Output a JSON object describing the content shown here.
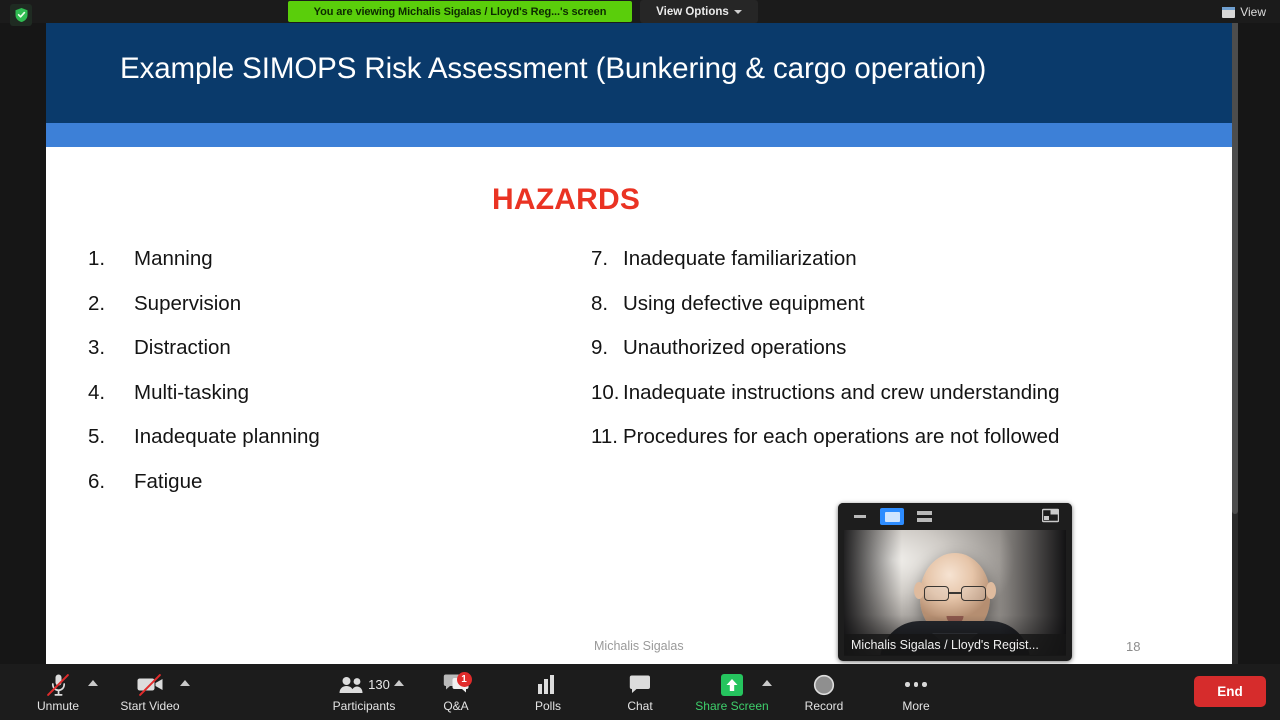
{
  "topbar": {
    "security_icon": "shield-check-icon",
    "viewing_banner": "You are viewing Michalis Sigalas / Lloyd's Reg...'s screen",
    "view_options_label": "View Options",
    "view_options_icon": "chevron-down-icon",
    "view_label": "View",
    "view_icon": "layout-window-icon"
  },
  "slide": {
    "title": "Example SIMOPS Risk Assessment  (Bunkering & cargo operation)",
    "heading": "HAZARDS",
    "heading_color": "#ea3323",
    "header_color": "#0a3a6b",
    "accent_color": "#3d80d7",
    "left_items": [
      {
        "num": "1.",
        "text": "Manning"
      },
      {
        "num": "2.",
        "text": "Supervision"
      },
      {
        "num": "3.",
        "text": "Distraction"
      },
      {
        "num": "4.",
        "text": "Multi-tasking"
      },
      {
        "num": "5.",
        "text": "Inadequate planning"
      },
      {
        "num": "6.",
        "text": "Fatigue"
      }
    ],
    "right_items": [
      {
        "num": "7.",
        "text": "Inadequate familiarization"
      },
      {
        "num": "8.",
        "text": "Using defective equipment"
      },
      {
        "num": "9.",
        "text": "Unauthorized operations"
      },
      {
        "num": "10.",
        "text": "Inadequate instructions and crew understanding"
      },
      {
        "num": "11.",
        "text": "Procedures for each operations are not followed"
      }
    ],
    "footer_name": "Michalis Sigalas",
    "page_number": "18"
  },
  "video_panel": {
    "minimize_icon": "minimize-icon",
    "speaker_view_icon": "speaker-view-icon",
    "gallery_view_icon": "gallery-view-icon",
    "popout_icon": "popout-window-icon",
    "participant_name": "Michalis Sigalas / Lloyd's Regist..."
  },
  "toolbar": {
    "left": [
      {
        "label": "Unmute",
        "icon": "microphone-muted-icon",
        "has_caret": true
      },
      {
        "label": "Start Video",
        "icon": "video-camera-off-icon",
        "has_caret": true
      }
    ],
    "center": [
      {
        "label": "Participants",
        "icon": "participants-icon",
        "count": "130",
        "has_caret": true
      },
      {
        "label": "Q&A",
        "icon": "qa-chat-icon",
        "badge": "1"
      },
      {
        "label": "Polls",
        "icon": "polls-bar-icon"
      },
      {
        "label": "Chat",
        "icon": "chat-bubble-icon"
      },
      {
        "label": "Share Screen",
        "icon": "share-screen-icon",
        "highlight": "#3ecf6b",
        "has_caret": true
      },
      {
        "label": "Record",
        "icon": "record-circle-icon"
      },
      {
        "label": "More",
        "icon": "more-dots-icon"
      }
    ],
    "end_label": "End",
    "end_color": "#d62c2c"
  }
}
